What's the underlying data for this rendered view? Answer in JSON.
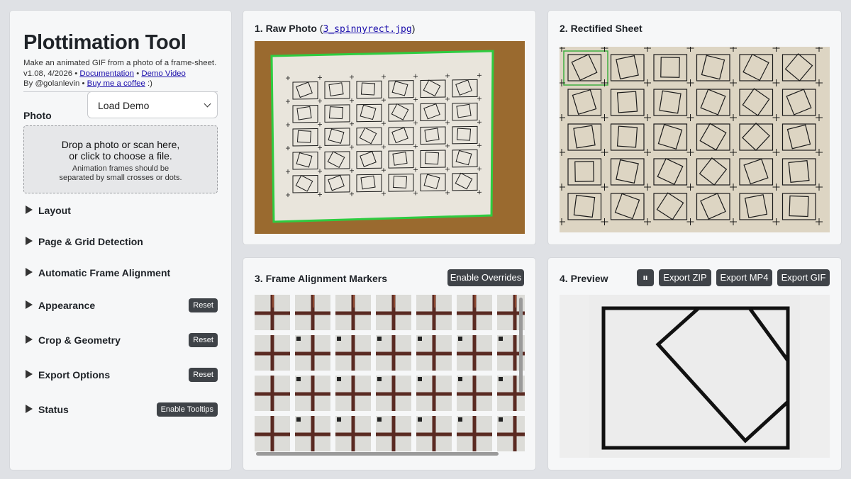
{
  "app": {
    "title": "Plottimation Tool",
    "tagline": "Make an animated GIF from a photo of a frame-sheet.",
    "version": "v1.08, 4/2026",
    "documentation_link": "Documentation",
    "demo_video_link": "Demo Video",
    "by_text": "By @golanlevin",
    "coffee_link": "Buy me a coffee",
    "coffee_suffix": ":)",
    "separator": "•"
  },
  "photo": {
    "label": "Photo",
    "select_value": "Load Demo"
  },
  "dropzone": {
    "line1": "Drop a photo or scan here,",
    "line2": "or click to choose a file.",
    "hint1": "Animation frames should be",
    "hint2": "separated by small crosses or dots."
  },
  "sections": [
    {
      "label": "Layout"
    },
    {
      "label": "Page & Grid Detection"
    },
    {
      "label": "Automatic Frame Alignment"
    },
    {
      "label": "Appearance",
      "button": "Reset"
    },
    {
      "label": "Crop & Geometry",
      "button": "Reset"
    },
    {
      "label": "Export Options",
      "button": "Reset"
    },
    {
      "label": "Status",
      "button": "Enable Tooltips"
    }
  ],
  "panels": {
    "raw": {
      "title": "1. Raw Photo",
      "filename": "3_spinnyrect.jpg",
      "open_paren": "(",
      "close_paren": ")"
    },
    "rectified": {
      "title": "2. Rectified Sheet"
    },
    "markers": {
      "title": "3. Frame Alignment Markers",
      "button": "Enable Overrides"
    },
    "preview": {
      "title": "4. Preview",
      "pause_icon": "pause-icon",
      "buttons": [
        "Export ZIP",
        "Export MP4",
        "Export GIF"
      ]
    }
  },
  "colors": {
    "background": "#dfe1e5",
    "panel": "#f6f7f8",
    "button": "#3f4348",
    "link": "#1a0dab",
    "page_border_highlight": "#2ecc40",
    "table_wood": "#9a6a2f",
    "paper": "#e9e5dc",
    "ink": "#1a1a1a",
    "marker_ink": "#5a2a22"
  }
}
